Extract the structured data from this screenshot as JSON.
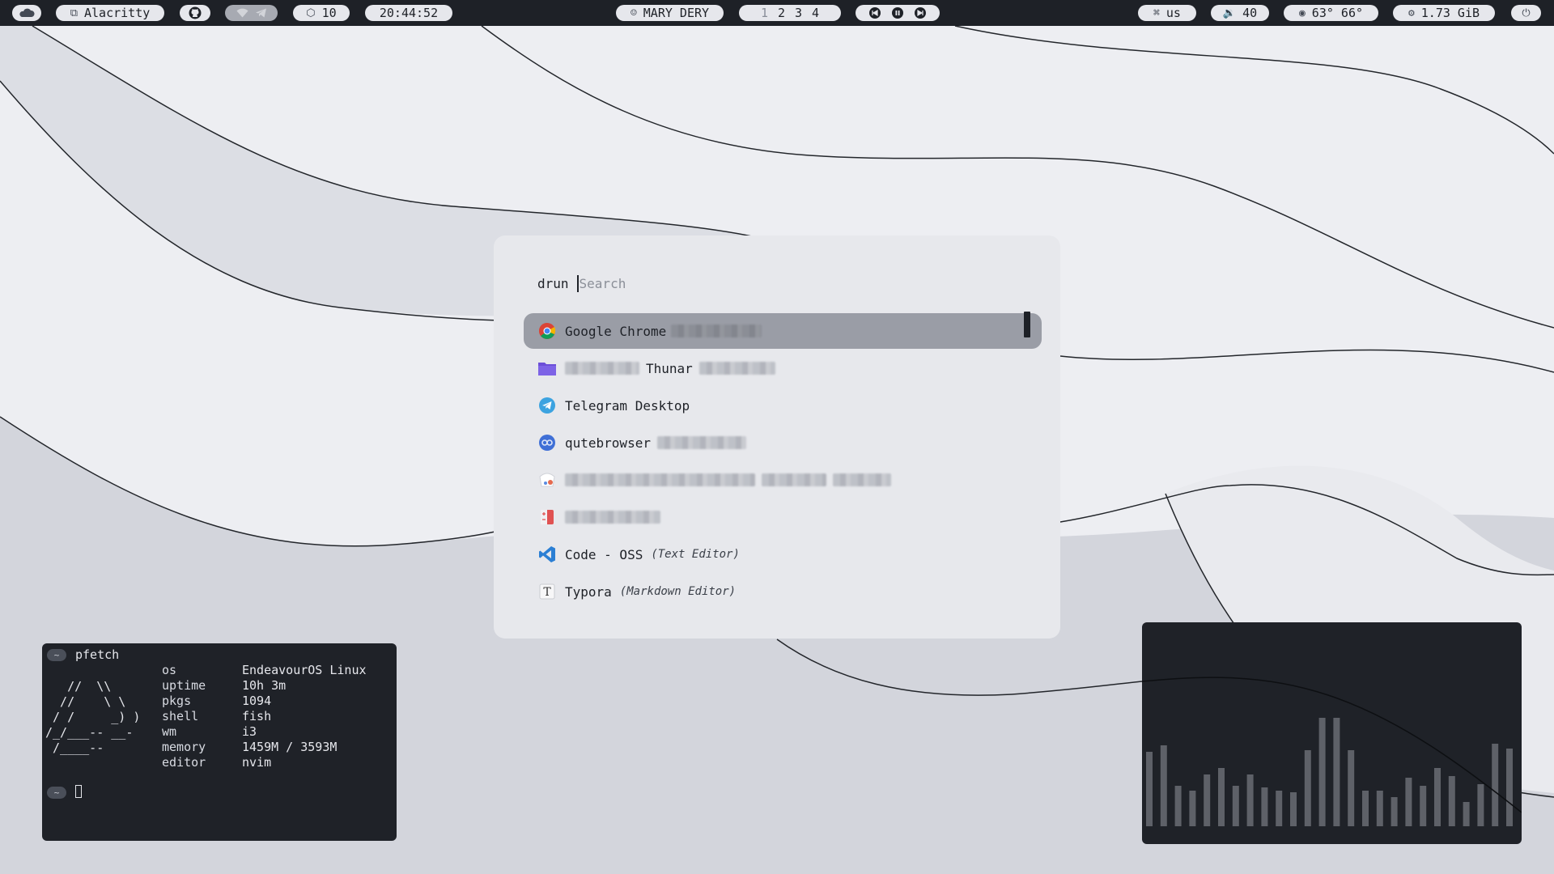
{
  "bar": {
    "window_title": "Alacritty",
    "package_updates": "10",
    "clock": "20:44:52",
    "user": "MARY DERY",
    "workspaces": [
      "1",
      "2",
      "3",
      "4"
    ],
    "keyboard_layout": "us",
    "volume": "40",
    "temperature": "63° 66°",
    "memory_used": "1.73 GiB"
  },
  "launcher": {
    "mode": "drun",
    "search_placeholder": "Search",
    "items": [
      {
        "name": "Google Chrome",
        "subtitle": "",
        "icon": "chrome-icon",
        "selected": true
      },
      {
        "name": "Thunar",
        "subtitle": "",
        "icon": "folder-icon",
        "selected": false
      },
      {
        "name": "Telegram Desktop",
        "subtitle": "",
        "icon": "telegram-icon",
        "selected": false
      },
      {
        "name": "qutebrowser",
        "subtitle": "",
        "icon": "qutebrowser-icon",
        "selected": false
      },
      {
        "name": "",
        "subtitle": "",
        "icon": "app-icon",
        "selected": false
      },
      {
        "name": "",
        "subtitle": "",
        "icon": "notes-icon",
        "selected": false
      },
      {
        "name": "Code - OSS",
        "subtitle": "(Text Editor)",
        "icon": "vscode-icon",
        "selected": false
      },
      {
        "name": "Typora",
        "subtitle": "(Markdown Editor)",
        "icon": "typora-icon",
        "selected": false
      }
    ]
  },
  "terminal": {
    "prompt_symbol": "~",
    "command": "pfetch",
    "info": [
      {
        "key": "os",
        "value": "EndeavourOS Linux"
      },
      {
        "key": "uptime",
        "value": "10h 3m"
      },
      {
        "key": "pkgs",
        "value": "1094"
      },
      {
        "key": "shell",
        "value": "fish"
      },
      {
        "key": "wm",
        "value": "i3"
      },
      {
        "key": "memory",
        "value": "1459M / 3593M"
      },
      {
        "key": "editor",
        "value": "nvim"
      }
    ]
  },
  "visualizer": {
    "levels": [
      0.46,
      0.5,
      0.25,
      0.22,
      0.32,
      0.36,
      0.25,
      0.32,
      0.24,
      0.22,
      0.21,
      0.47,
      0.67,
      0.67,
      0.47,
      0.22,
      0.22,
      0.18,
      0.3,
      0.25,
      0.36,
      0.31,
      0.15,
      0.26,
      0.51,
      0.48
    ]
  },
  "colors": {
    "bar_bg": "#1e2127",
    "pill_bg": "#e6e7ec",
    "launcher_bg": "#e7e8ec",
    "selected_row": "#9a9da6",
    "terminal_bg": "#1f2228",
    "visualizer_bar": "#5e6168"
  }
}
